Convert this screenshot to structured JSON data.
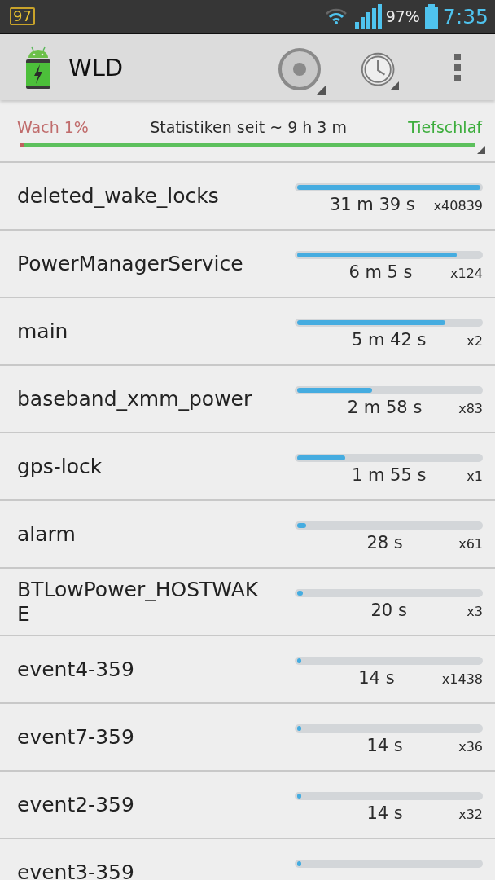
{
  "status_bar": {
    "notification": "97",
    "battery": "97%",
    "time": "7:35"
  },
  "action_bar": {
    "title": "WLD"
  },
  "summary": {
    "awake": "Wach 1%",
    "period": "Statistiken seit ~ 9 h 3 m",
    "deep_sleep": "Tiefschlaf",
    "level": 0.01
  },
  "wakelocks": [
    {
      "name": "deleted_wake_locks",
      "level": 1.0,
      "duration": "31 m 39 s",
      "count": "x40839"
    },
    {
      "name": "PowerManagerService",
      "level": 0.87,
      "duration": "6 m 5 s",
      "count": "x124"
    },
    {
      "name": "main",
      "level": 0.81,
      "duration": "5 m 42 s",
      "count": "x2"
    },
    {
      "name": "baseband_xmm_power",
      "level": 0.41,
      "duration": "2 m 58 s",
      "count": "x83"
    },
    {
      "name": "gps-lock",
      "level": 0.26,
      "duration": "1 m 55 s",
      "count": "x1"
    },
    {
      "name": "alarm",
      "level": 0.05,
      "duration": "28 s",
      "count": "x61"
    },
    {
      "name": "BTLowPower_HOSTWAKE",
      "level": 0.03,
      "duration": "20 s",
      "count": "x3"
    },
    {
      "name": "event4-359",
      "level": 0.02,
      "duration": "14 s",
      "count": "x1438"
    },
    {
      "name": "event7-359",
      "level": 0.02,
      "duration": "14 s",
      "count": "x36"
    },
    {
      "name": "event2-359",
      "level": 0.02,
      "duration": "14 s",
      "count": "x32"
    },
    {
      "name": "event3-359",
      "level": 0.02
    }
  ]
}
